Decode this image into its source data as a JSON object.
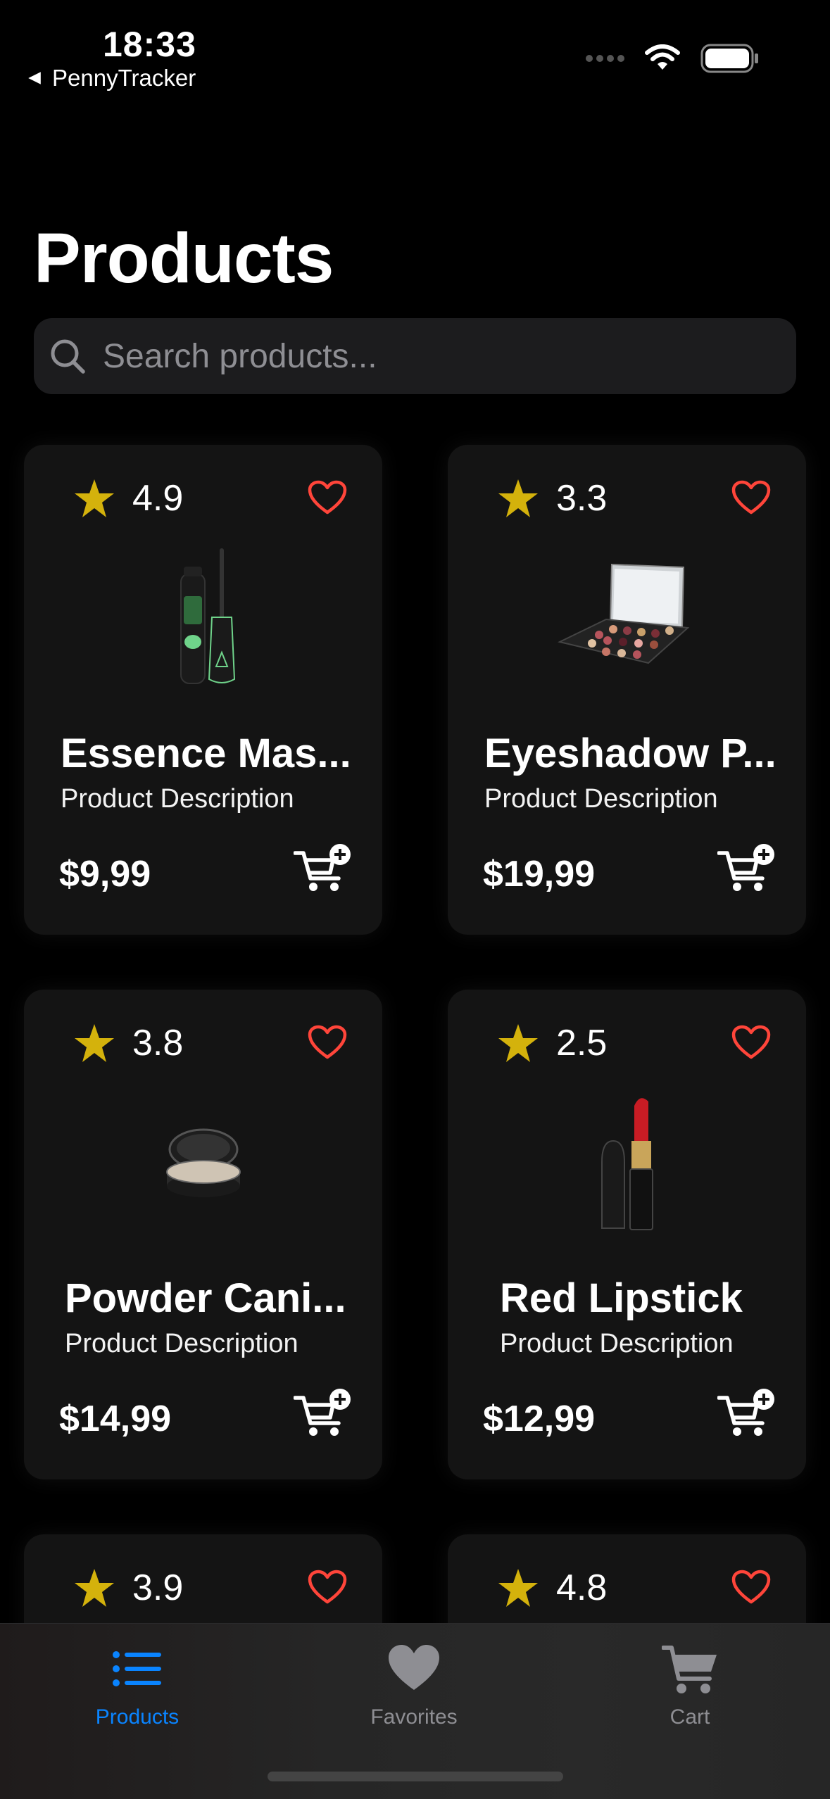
{
  "status_bar": {
    "time": "18:33",
    "back_app": "PennyTracker"
  },
  "header": {
    "title": "Products"
  },
  "search": {
    "placeholder": "Search products..."
  },
  "colors": {
    "star": "#d4b20c",
    "heart": "#ff453a",
    "accent": "#0a84ff"
  },
  "products": [
    {
      "rating": "4.9",
      "name": "Essence Mas...",
      "description": "Product Description",
      "price": "$9,99",
      "image": "mascara-image"
    },
    {
      "rating": "3.3",
      "name": "Eyeshadow P...",
      "description": "Product Description",
      "price": "$19,99",
      "image": "eyeshadow-palette-image"
    },
    {
      "rating": "3.8",
      "name": "Powder Cani...",
      "description": "Product Description",
      "price": "$14,99",
      "image": "powder-compact-image"
    },
    {
      "rating": "2.5",
      "name": "Red Lipstick",
      "description": "Product Description",
      "price": "$12,99",
      "image": "lipstick-image"
    },
    {
      "rating": "3.9"
    },
    {
      "rating": "4.8"
    }
  ],
  "tabs": [
    {
      "label": "Products",
      "icon": "list-icon",
      "active": true
    },
    {
      "label": "Favorites",
      "icon": "heart-icon",
      "active": false
    },
    {
      "label": "Cart",
      "icon": "cart-icon",
      "active": false
    }
  ]
}
